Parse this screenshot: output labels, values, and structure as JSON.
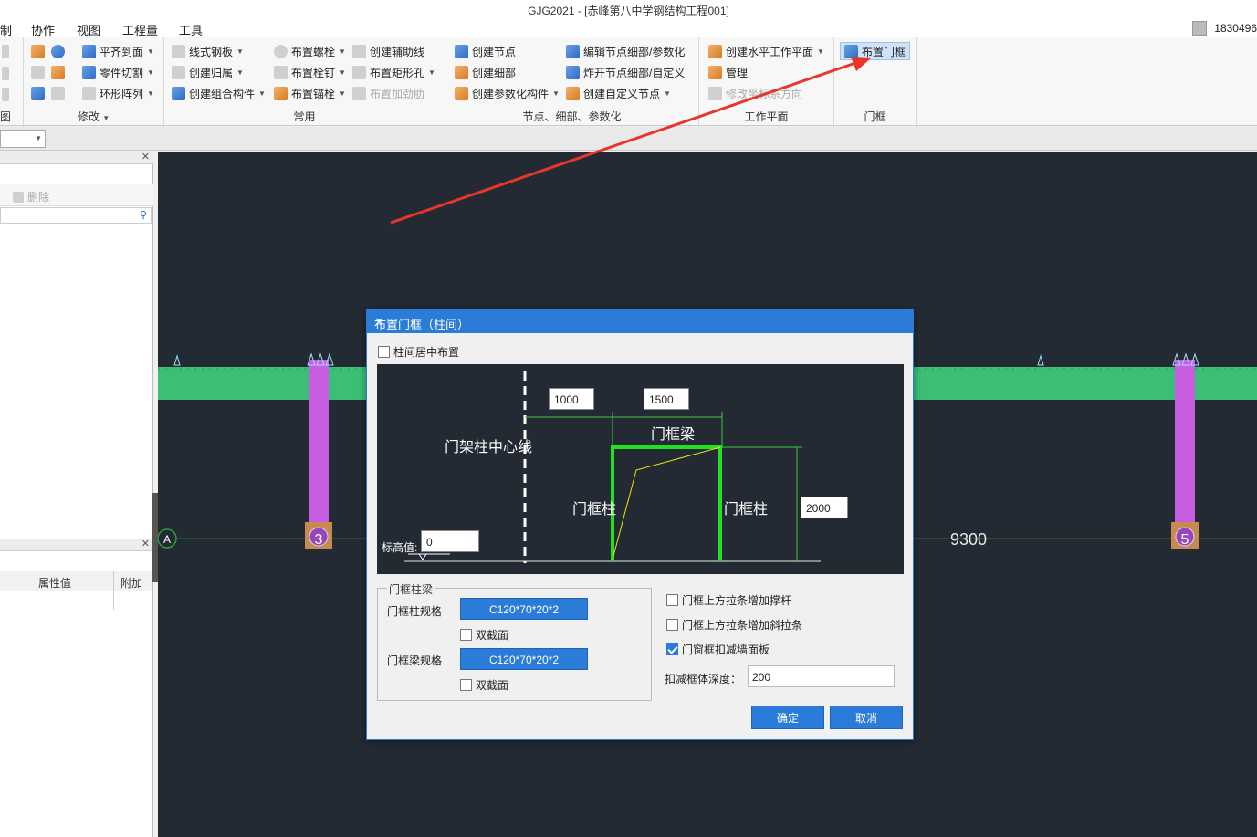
{
  "app": {
    "title": "GJG2021 - [赤峰第八中学钢结构工程001]",
    "user": "1830496"
  },
  "menu": [
    "制",
    "协作",
    "视图",
    "工程量",
    "工具"
  ],
  "ribbon": {
    "group_modify_label": "修改",
    "group_view_label": "图",
    "modify_items": [
      "平齐到面",
      "零件切割",
      "环形阵列"
    ],
    "common_label": "常用",
    "common_items": [
      "线式钢板",
      "创建归属",
      "创建组合构件",
      "布置螺栓",
      "布置栓钉",
      "布置锚栓",
      "创建辅助线",
      "布置矩形孔",
      "布置加劲肋"
    ],
    "node_label": "节点、细部、参数化",
    "node_items": [
      "创建节点",
      "创建细部",
      "创建参数化构件",
      "编辑节点细部/参数化",
      "炸开节点细部/自定义",
      "创建自定义节点"
    ],
    "workplane_label": "工作平面",
    "workplane_items": [
      "创建水平工作平面",
      "管理",
      "修改坐标系方向"
    ],
    "door_label": "门框",
    "door_button": "布置门框"
  },
  "left_panel": {
    "delete_label": "删除",
    "prop_value_col": "属性值",
    "extra_col": "附加"
  },
  "canvas": {
    "axis_a": "A",
    "axis_3": "3",
    "axis_5": "5",
    "dimension": "9300"
  },
  "dialog": {
    "title": "布置门框（柱间）",
    "center_checkbox": "柱间居中布置",
    "center_checked": false,
    "preview": {
      "offset_value": "1000",
      "width_value": "1500",
      "height_value": "2000",
      "elevation_label": "标高值:",
      "elevation_value": "0",
      "center_line_label": "门架柱中心线",
      "beam_label": "门框梁",
      "column_left_label": "门框柱",
      "column_right_label": "门框柱"
    },
    "group_title": "门框柱梁",
    "column_spec_label": "门框柱规格",
    "column_spec_value": "C120*70*20*2",
    "column_double_label": "双截面",
    "beam_spec_label": "门框梁规格",
    "beam_spec_value": "C120*70*20*2",
    "beam_double_label": "双截面",
    "option_brace": "门框上方拉条增加撑杆",
    "option_diagonal": "门框上方拉条增加斜拉条",
    "option_deduct": "门窗框扣减墙面板",
    "option_deduct_checked": true,
    "deduct_depth_label": "扣减框体深度：",
    "deduct_depth_value": "200",
    "ok_label": "确定",
    "cancel_label": "取消"
  }
}
